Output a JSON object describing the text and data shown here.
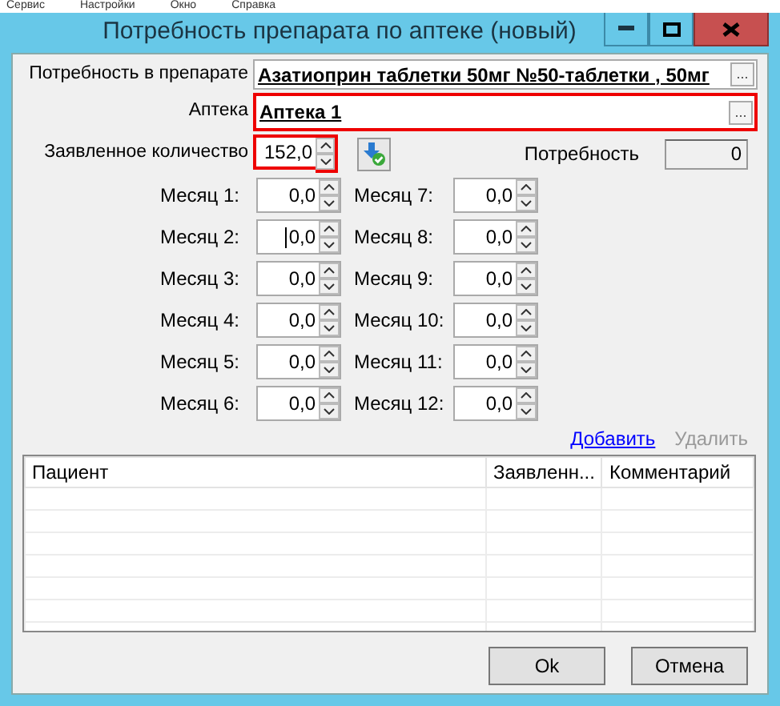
{
  "menu_bar": [
    "Сервис",
    "Настройки",
    "Окно",
    "Справка"
  ],
  "window": {
    "title": "Потребность препарата по аптеке (новый)"
  },
  "drug": {
    "label": "Потребность в препарате",
    "value": "Азатиоприн таблетки  50мг №50-таблетки , 50мг",
    "button": "...",
    "highlighted": false
  },
  "pharmacy": {
    "label": "Аптека",
    "value": "Аптека 1",
    "button": "...",
    "highlighted": true
  },
  "declared_quantity": {
    "label": "Заявленное количество",
    "value": "152,0",
    "highlighted": true
  },
  "need": {
    "label": "Потребность",
    "value": "0"
  },
  "months": [
    {
      "label": "Месяц 1:",
      "value": "0,0",
      "focused": false
    },
    {
      "label": "Месяц 2:",
      "value": "0,0",
      "focused": true
    },
    {
      "label": "Месяц 3:",
      "value": "0,0",
      "focused": false
    },
    {
      "label": "Месяц 4:",
      "value": "0,0",
      "focused": false
    },
    {
      "label": "Месяц 5:",
      "value": "0,0",
      "focused": false
    },
    {
      "label": "Месяц 6:",
      "value": "0,0",
      "focused": false
    },
    {
      "label": "Месяц 7:",
      "value": "0,0",
      "focused": false
    },
    {
      "label": "Месяц 8:",
      "value": "0,0",
      "focused": false
    },
    {
      "label": "Месяц 9:",
      "value": "0,0",
      "focused": false
    },
    {
      "label": "Месяц 10:",
      "value": "0,0",
      "focused": false
    },
    {
      "label": "Месяц 11:",
      "value": "0,0",
      "focused": false
    },
    {
      "label": "Месяц 12:",
      "value": "0,0",
      "focused": false
    }
  ],
  "actions": [
    {
      "label": "Добавить",
      "disabled": false
    },
    {
      "label": "Удалить",
      "disabled": true
    }
  ],
  "table": {
    "columns": [
      "Пациент",
      "Заявленн...",
      "Комментарий"
    ]
  },
  "buttons": [
    "Ok",
    "Отмена"
  ]
}
